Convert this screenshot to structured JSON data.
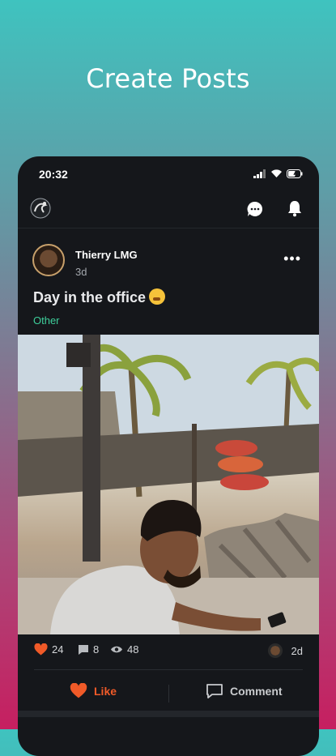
{
  "headline": "Create Posts",
  "status_bar": {
    "time": "20:32"
  },
  "app_bar": {
    "icons": [
      "app-logo",
      "chat-icon",
      "bell-icon"
    ]
  },
  "post": {
    "author": "Thierry LMG",
    "time_ago": "3d",
    "title": "Day in the office",
    "category": "Other",
    "stats": {
      "likes": "24",
      "comments": "8",
      "views": "48",
      "age": "2d"
    },
    "actions": {
      "like_label": "Like",
      "comment_label": "Comment"
    }
  },
  "colors": {
    "like_accent": "#f05a28",
    "category_accent": "#3ecf9b",
    "phone_bg": "#15171b"
  }
}
